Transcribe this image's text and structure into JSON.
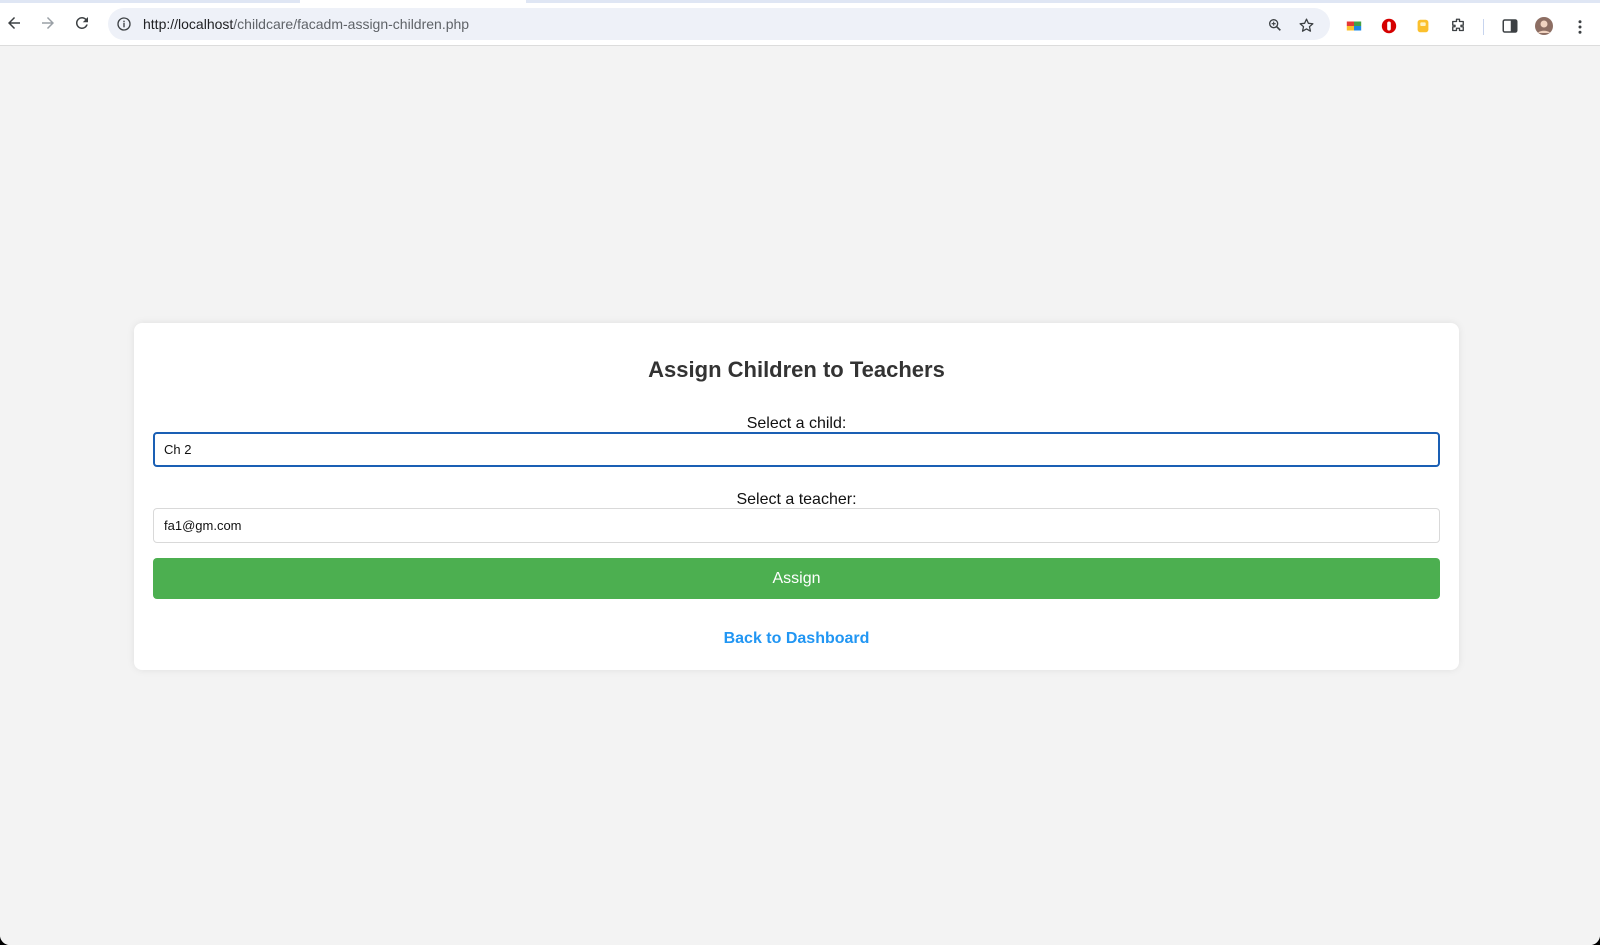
{
  "browser": {
    "url_host": "http://localhost",
    "url_path": "/childcare/facadm-assign-children.php",
    "icons": [
      "back-arrow-icon",
      "forward-arrow-icon",
      "reload-icon",
      "site-info-icon",
      "zoom-icon",
      "bookmark-star-icon",
      "extension-icon",
      "side-panel-icon",
      "profile-avatar",
      "menu-dots-icon"
    ]
  },
  "form": {
    "title": "Assign Children to Teachers",
    "child_label": "Select a child:",
    "child_value": "Ch 2",
    "teacher_label": "Select a teacher:",
    "teacher_value": "fa1@gm.com",
    "submit_label": "Assign",
    "back_link": "Back to Dashboard"
  },
  "colors": {
    "assign_button": "#4caf50",
    "link": "#2196f3",
    "focus_border": "#1a5fb4",
    "page_background": "#f3f3f3"
  }
}
